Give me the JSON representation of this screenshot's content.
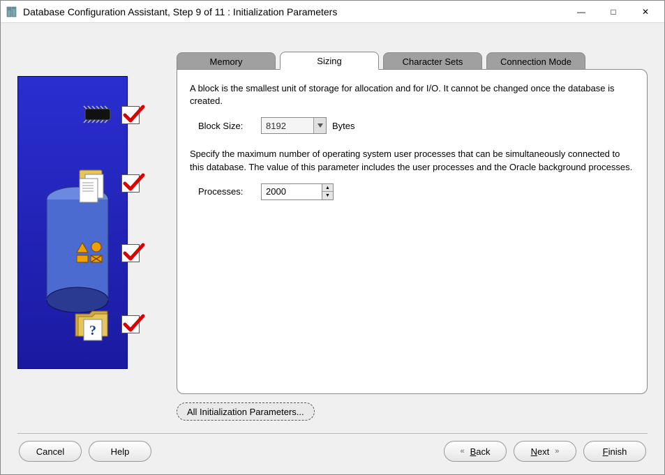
{
  "window": {
    "title": "Database Configuration Assistant, Step 9 of 11 : Initialization Parameters"
  },
  "win_controls": {
    "minimize": "—",
    "maximize": "□",
    "close": "✕"
  },
  "tabs": {
    "memory": "Memory",
    "sizing": "Sizing",
    "charsets": "Character Sets",
    "conn": "Connection Mode"
  },
  "sizing": {
    "block_desc": "A block is the smallest unit of storage for allocation and for I/O. It cannot be changed once the database is created.",
    "block_label": "Block Size:",
    "block_value": "8192",
    "block_unit": "Bytes",
    "proc_desc": "Specify the maximum number of operating system user processes that can be simultaneously connected to this database. The value of this parameter includes the user processes and the Oracle background processes.",
    "proc_label": "Processes:",
    "proc_value": "2000"
  },
  "buttons": {
    "all_params": "All Initialization Parameters...",
    "cancel": "Cancel",
    "help": "Help",
    "back": "Back",
    "next": "Next",
    "finish": "Finish"
  }
}
